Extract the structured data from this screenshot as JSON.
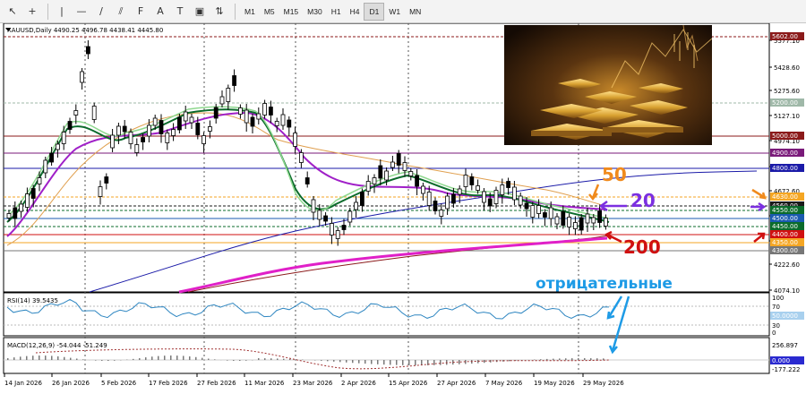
{
  "toolbar": {
    "timeframes": [
      "M1",
      "M5",
      "M15",
      "M30",
      "H1",
      "H4",
      "D1",
      "W1",
      "MN"
    ],
    "active_timeframe": "D1"
  },
  "chart": {
    "header": "XAUUSD,Daily  4490.25 4496.78 4438.41 4445.80",
    "price_ticks": [
      "5577.10",
      "5428.60",
      "5275.60",
      "5127.10",
      "4974.10",
      "4822.00",
      "4672.60",
      "4519.60",
      "4371.10",
      "4222.60",
      "4074.10"
    ],
    "level_labels": [
      {
        "text": "5602.00",
        "bg": "#8b1a1a",
        "fg": "#ffffff"
      },
      {
        "text": "5200.00",
        "bg": "#9fb8a8",
        "fg": "#ffffff"
      },
      {
        "text": "5000.00",
        "bg": "#8b1a1a",
        "fg": "#ffffff"
      },
      {
        "text": "4900.00",
        "bg": "#7a1a7a",
        "fg": "#ffffff"
      },
      {
        "text": "4800.00",
        "bg": "#1a1aa8",
        "fg": "#ffffff"
      },
      {
        "text": "4630.00",
        "bg": "#f5a623",
        "fg": "#ffffff"
      },
      {
        "text": "4560.00",
        "bg": "#1a1a1a",
        "fg": "#ffffff"
      },
      {
        "text": "4550.00",
        "bg": "#0b6b2b",
        "fg": "#ffffff"
      },
      {
        "text": "4500.00",
        "bg": "#1a5ab0",
        "fg": "#ffffff"
      },
      {
        "text": "4450.00",
        "bg": "#0b6b2b",
        "fg": "#ffffff"
      },
      {
        "text": "4400.00",
        "bg": "#d01010",
        "fg": "#ffffff"
      },
      {
        "text": "4350.00",
        "bg": "#f5a623",
        "fg": "#ffffff"
      },
      {
        "text": "4300.00",
        "bg": "#777777",
        "fg": "#ffffff"
      }
    ],
    "date_labels": [
      "14 Jan 2026",
      "26 Jan 2026",
      "5 Feb 2026",
      "17 Feb 2026",
      "27 Feb 2026",
      "11 Mar 2026",
      "23 Mar 2026",
      "2 Apr 2026",
      "15 Apr 2026",
      "27 Apr 2026",
      "7 May 2026",
      "19 May 2026",
      "29 May 2026"
    ],
    "annotations": {
      "ma50": "50",
      "ma20": "20",
      "ma200": "200",
      "negative": "отрицательные"
    },
    "colors": {
      "bull": "#ffffff",
      "bear": "#000000",
      "ma20": "#a020c8",
      "ma50": "#e0a050",
      "ma200": "#e020c8",
      "ma_fast": "#0b6b2b",
      "annot_orange": "#f08a1c",
      "annot_purple": "#7b2fe0",
      "annot_red": "#d01010",
      "annot_blue": "#1e9be6"
    }
  },
  "rsi": {
    "header": "RSI(14) 39.5435",
    "ticks": [
      "100",
      "70",
      "30",
      "0"
    ],
    "value_label": "50.0000"
  },
  "macd": {
    "header": "MACD(12,26,9) -54.044 -51.249",
    "ticks": [
      "256.897",
      "0.000",
      "-177.222"
    ]
  }
}
